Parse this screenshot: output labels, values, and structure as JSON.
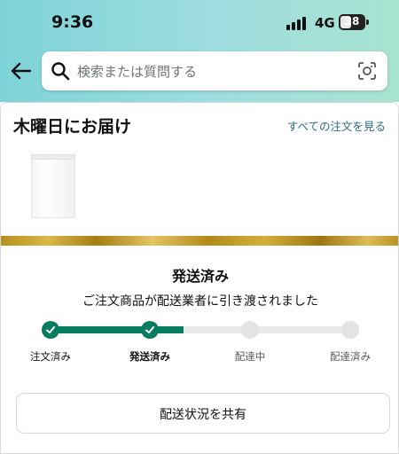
{
  "status_bar": {
    "time": "9:36",
    "network": "4G",
    "battery": "38"
  },
  "search": {
    "placeholder": "検索または質問する"
  },
  "delivery": {
    "title": "木曜日にお届け",
    "all_orders_link": "すべての注文を見る"
  },
  "shipment": {
    "status_title": "発送済み",
    "status_description": "ご注文商品が配送業者に引き渡されました",
    "steps": [
      {
        "label": "注文済み",
        "state": "done"
      },
      {
        "label": "発送済み",
        "state": "current"
      },
      {
        "label": "配達中",
        "state": "pending"
      },
      {
        "label": "配達済み",
        "state": "pending"
      }
    ]
  },
  "share_button": {
    "label": "配送状況を共有"
  },
  "colors": {
    "accent_green": "#067d62",
    "link": "#2a6f86",
    "gold": "#c9a233"
  }
}
